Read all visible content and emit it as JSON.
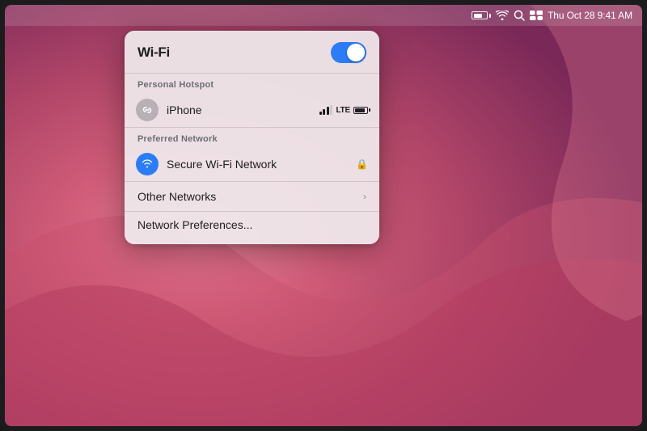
{
  "menubar": {
    "time": "Thu Oct 28  9:41 AM",
    "battery_level": 70,
    "icons": [
      "battery",
      "wifi",
      "search",
      "control-center"
    ]
  },
  "wifi_panel": {
    "title": "Wi-Fi",
    "toggle_on": true,
    "sections": {
      "personal_hotspot": {
        "label": "Personal Hotspot",
        "network": {
          "name": "iPhone",
          "signal_bars": 3,
          "connection_type": "LTE",
          "battery": 85
        }
      },
      "preferred_network": {
        "label": "Preferred Network",
        "network": {
          "name": "Secure Wi-Fi Network",
          "locked": true
        }
      },
      "other_networks": {
        "label": "Other Networks"
      },
      "preferences": {
        "label": "Network Preferences..."
      }
    }
  }
}
